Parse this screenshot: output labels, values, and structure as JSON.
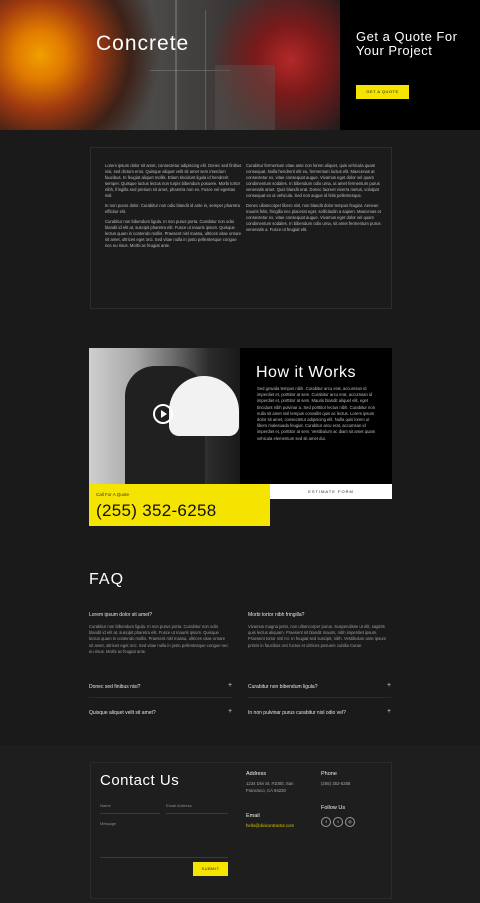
{
  "hero": {
    "title": "Concrete"
  },
  "quote": {
    "title": "Get a Quote For Your Project",
    "button_label": "GET A QUOTE",
    "accent_color": "#f5e400"
  },
  "text_section": {
    "left_paragraphs": [
      "Lorem ipsum dolor sit amet, consectetur adipiscing elit. Donec sed finibus nisi, sed dictum eros. Quisque aliquet velit sit amet sem interdum faucibus. In feugiat aliquet mollis. Etiam tincidunt ligula id hendrerit semper. Quisque luctus lectus non turpis bibendum posuere. Morbi tortor nibh, fringilla sed pretium sit amet, pharetra non ex. Fusce vel egestas nisl.",
      "In non purus dolor. Curabitur non odio blandit id ante in, semper pharetra efficitur elit.",
      "Curabitur non bibendum ligula. In non purus porta. Curabitur non odio blandit id elit at, suscipit pharetra elit. Fusce ut mauris ipsum. Quisque lectus quam in contendo mollis. Praesent nisl massa, ultrices vitae ornare sit amet, ultrices eget orci. Sed vitae nulla in justo pellentesque congue nec eu risus. Morbi ac feugiat ante."
    ],
    "right_paragraphs": [
      "Curabitur fermentum vitae ante non lorem aliquet, quis vehicula quam consequat. Nulla hendrerit elit eu, fermentum luctus elit. Maecenas at consectetur ex, vitae consequat augue. Vivamus eget dolor vel quam condimentum sodales. In bibendum odio urna, ut amet fermentum purus venenatis amet. Quis blandit erat. Donec laoreet viverra metus, volutpat consequat ex ut vehicula. Sed non augue id felis pellentesque.",
      "Donec ullamcorper libero nisl, non blandit dolor tempus feugiat. Aenean mauris felis, fringilla nec placerat eget, sollicitudin a sapien. Maecenas et consectetur ex, vitae consequat augue. Vivamus eget dolor vel quam condimentum sodales. In bibendum odio urna, sit amet fermentum purus venenatis a. Fusce ut feugiat elit."
    ]
  },
  "how": {
    "title": "How it Works",
    "text": "Sed gravida tempus nibh. Curabitur arcu erat, accumsan id imperdiet et, porttitor at sem. Curabitur arcu erat, accumsan id imperdiet et, porttitor at sem. Mauris blandit aliquet elit, eget tincidunt nibh pulvinar a. Sed porttitor lectus nibh. Curabitur non nulla sit amet nisl tempus convallis quis ac lectus. Lorem ipsum dolor sit amet, consectetur adipiscing elit. Nulla quis lorem ut libero malesuada feugiat. Curabitur arcu erat, accumsan id imperdiet et, porttitor at sem. Vestibulum ac diam sit amet quam vehicula elementum sed sit amet dui.",
    "estimate_label": "ESTIMATE FORM",
    "call_label": "Call For A Quote",
    "phone": "(255) 352-6258"
  },
  "faq": {
    "title": "FAQ",
    "expanded": [
      {
        "question": "Lorem ipsum dolor sit amet?",
        "answer": "Curabitur non bibendum ligula. In non purus porta. Curabitur non odio blandit id elit at, suscipit pharetra elit. Fusce ut mauris ipsum. Quisque lectus quam in contendo mollis. Praesent nisl massa, ultrices vitae ornare sit amet, ultrices eget orci. Sed vitae nulla in justo pellentesque congue nec eu risus. Morbi ac feugiat ante."
      },
      {
        "question": "Morbi tortor nibh fringilla?",
        "answer": "Vivamus magna justo, non ullamcorper purus. Suspendisse ut elit, sagittis quis lectus aliquam. Praesent sit blandit mauris, nibh imperdiet ipsum. Praesent tortor nisl mi. In feugiat sed suscipit, nibh. Vestibulum ante ipsum primis in faucibus orci luctus et ultrices posuere cubilia Curae."
      }
    ],
    "collapsed": [
      {
        "question": "Donec sed finibus nisi?"
      },
      {
        "question": "Curabitur non bibendum ligula?"
      },
      {
        "question": "Quisque aliquet velit sit amet?"
      },
      {
        "question": "In non pulvinar purus curabitur nisl odio vel?"
      }
    ]
  },
  "contact": {
    "title": "Contact Us",
    "name_placeholder": "Name",
    "email_placeholder": "Email Address",
    "message_placeholder": "Message",
    "submit_label": "SUBMIT",
    "address_heading": "Address",
    "address": "1234 Divi St. #1000, San Francisco, CA 94220",
    "email_heading": "Email",
    "email": "hello@divicontractor.com",
    "phone_heading": "Phone",
    "phone": "(255) 352-6258",
    "follow_heading": "Follow Us",
    "social_icons": [
      "facebook-icon",
      "twitter-icon",
      "instagram-icon"
    ]
  }
}
